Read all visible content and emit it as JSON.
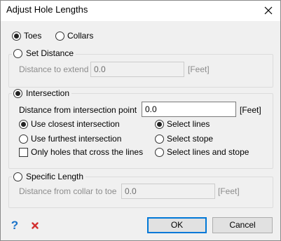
{
  "window": {
    "title": "Adjust Hole Lengths",
    "close_icon": "close-icon"
  },
  "target": {
    "options": [
      {
        "label": "Toes",
        "selected": true
      },
      {
        "label": "Collars",
        "selected": false
      }
    ]
  },
  "set_distance": {
    "label": "Set Distance",
    "selected": false,
    "field_label": "Distance to extend",
    "value": "0.0",
    "unit": "[Feet]",
    "enabled": false
  },
  "intersection": {
    "label": "Intersection",
    "selected": true,
    "field_label": "Distance from intersection point",
    "value": "0.0",
    "unit": "[Feet]",
    "mode_options": [
      {
        "label": "Use closest intersection",
        "selected": true
      },
      {
        "label": "Use furthest intersection",
        "selected": false
      }
    ],
    "only_cross_label": "Only holes that cross the lines",
    "only_cross_checked": false,
    "select_options": [
      {
        "label": "Select lines",
        "selected": true
      },
      {
        "label": "Select stope",
        "selected": false
      },
      {
        "label": "Select lines and stope",
        "selected": false
      }
    ]
  },
  "specific_length": {
    "label": "Specific Length",
    "selected": false,
    "field_label": "Distance from collar to toe",
    "value": "0.0",
    "unit": "[Feet]",
    "enabled": false
  },
  "footer": {
    "help_icon": "help-icon",
    "cancel_icon": "cancel-x-icon",
    "ok_label": "OK",
    "cancel_label": "Cancel",
    "help_color": "#1a73c9",
    "cancel_icon_color": "#d32f2f",
    "accent_color": "#0078d7"
  }
}
